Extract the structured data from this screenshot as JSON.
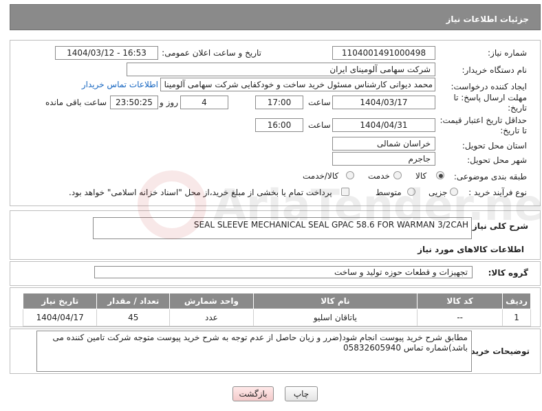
{
  "header": {
    "title": "جزئیات اطلاعات نیاز"
  },
  "form": {
    "need_number": {
      "label": "شماره نیاز:",
      "value": "1104001491000498"
    },
    "announce_datetime": {
      "label": "تاریخ و ساعت اعلان عمومی:",
      "value": "1404/03/12 - 16:53"
    },
    "buyer_org": {
      "label": "نام دستگاه خریدار:",
      "value": "شرکت سهامی آلومینای ایران"
    },
    "requester": {
      "label": "ایجاد کننده درخواست:",
      "value": "محمد دیوانی کارشناس مسئول خرید ساخت و خودکفایی شرکت سهامی آلومینا",
      "contact_link": "اطلاعات تماس خریدار"
    },
    "reply_deadline": {
      "label": "مهلت ارسال پاسخ: تا تاریخ:",
      "date": "1404/03/17",
      "time_label": "ساعت",
      "time": "17:00",
      "days": "4",
      "days_label": "روز و",
      "remaining": "23:50:25",
      "remaining_label": "ساعت باقی مانده"
    },
    "price_validity": {
      "label": "حداقل تاریخ اعتبار قیمت: تا تاریخ:",
      "date": "1404/04/31",
      "time_label": "ساعت",
      "time": "16:00"
    },
    "province": {
      "label": "استان محل تحویل:",
      "value": "خراسان شمالی"
    },
    "city": {
      "label": "شهر محل تحویل:",
      "value": "جاجرم"
    },
    "category": {
      "label": "طبقه بندی موضوعی:",
      "options": [
        "کالا",
        "خدمت",
        "کالا/خدمت"
      ],
      "selected": "کالا"
    },
    "purchase_type": {
      "label": "نوع فرآیند خرید :",
      "options": [
        "جزیی",
        "متوسط"
      ],
      "note": "پرداخت تمام یا بخشی از مبلغ خرید،از محل \"اسناد خزانه اسلامی\" خواهد بود."
    }
  },
  "description": {
    "label": "شرح کلی نیاز:",
    "value": "SEAL SLEEVE MECHANICAL SEAL GPAC 58.6 FOR WARMAN 3/2CAH"
  },
  "goods_info": {
    "title": "اطلاعات کالاهای مورد نیاز"
  },
  "goods_group": {
    "label": "گروه کالا:",
    "value": "تجهیزات و قطعات حوزه تولید و ساخت"
  },
  "table": {
    "headers": [
      "ردیف",
      "کد کالا",
      "نام کالا",
      "واحد شمارش",
      "تعداد / مقدار",
      "تاریخ نیاز"
    ],
    "rows": [
      [
        "1",
        "--",
        "یاتاقان اسلیو",
        "عدد",
        "45",
        "1404/04/17"
      ]
    ]
  },
  "buyer_notes": {
    "label": "توضیحات خریدار:",
    "value": "مطابق شرح خرید پیوست انجام شود(ضرر و زیان حاصل از عدم توجه به شرح خرید پیوست متوجه شرکت تامین کننده می باشد)شماره تماس 05832605940"
  },
  "buttons": {
    "print": "چاپ",
    "back": "بازگشت"
  },
  "watermark": {
    "text": "AriaTender.neT"
  }
}
